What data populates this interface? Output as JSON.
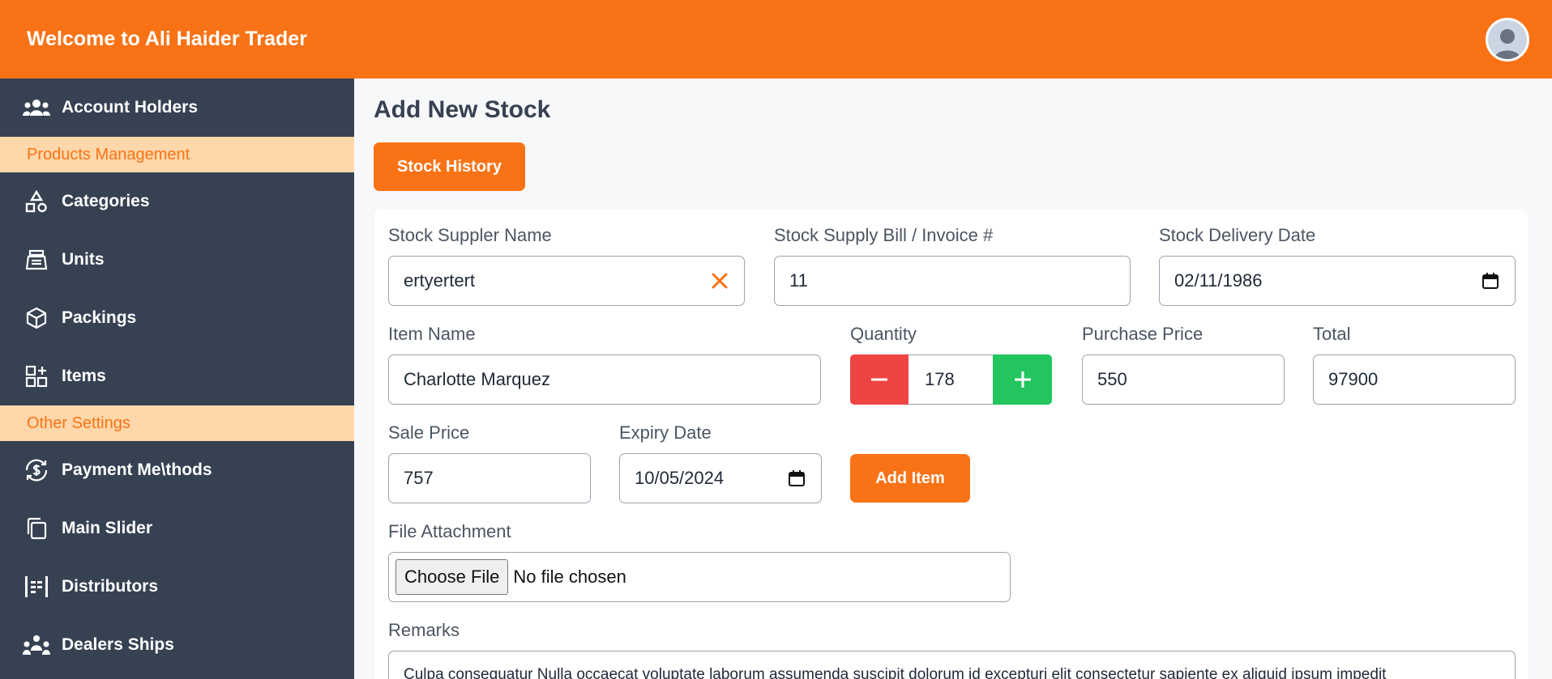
{
  "header": {
    "title": "Welcome to Ali Haider Trader"
  },
  "sidebar": {
    "items": [
      {
        "label": "Account Holders",
        "icon": "users-icon"
      },
      {
        "section": "Products Management"
      },
      {
        "label": "Categories",
        "icon": "shapes-icon"
      },
      {
        "label": "Units",
        "icon": "scale-icon"
      },
      {
        "label": "Packings",
        "icon": "box-icon"
      },
      {
        "label": "Items",
        "icon": "grid-plus-icon"
      },
      {
        "section": "Other Settings"
      },
      {
        "label": "Payment Me\\thods",
        "icon": "dollar-cycle-icon"
      },
      {
        "label": "Main Slider",
        "icon": "slides-icon"
      },
      {
        "label": "Distributors",
        "icon": "list-grid-icon"
      },
      {
        "label": "Dealers Ships",
        "icon": "people-group-icon"
      }
    ]
  },
  "main": {
    "title": "Add New Stock",
    "history_button": "Stock History",
    "form": {
      "supplier_label": "Stock Suppler Name",
      "supplier_value": "ertyertert",
      "invoice_label": "Stock Supply Bill / Invoice #",
      "invoice_value": "11",
      "delivery_label": "Stock Delivery Date",
      "delivery_value": "02/11/1986",
      "item_label": "Item Name",
      "item_value": "Charlotte Marquez",
      "quantity_label": "Quantity",
      "quantity_value": "178",
      "purchase_label": "Purchase Price",
      "purchase_value": "550",
      "total_label": "Total",
      "total_value": "97900",
      "sale_label": "Sale Price",
      "sale_value": "757",
      "expiry_label": "Expiry Date",
      "expiry_value": "10/05/2024",
      "add_item_button": "Add Item",
      "file_label": "File Attachment",
      "choose_file": "Choose File",
      "file_status": "No file chosen",
      "remarks_label": "Remarks",
      "remarks_value": "Culpa consequatur Nulla occaecat voluptate laborum assumenda suscipit dolorum id excepturi elit consectetur sapiente ex aliquid ipsum impedit"
    }
  },
  "colors": {
    "accent": "#f97316",
    "sidebar": "#364152",
    "section_bg": "#fed7aa",
    "minus": "#ef4444",
    "plus": "#22c55e"
  }
}
